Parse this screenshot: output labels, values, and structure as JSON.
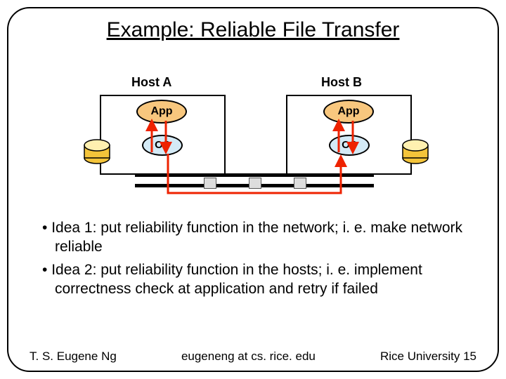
{
  "title": "Example: Reliable File Transfer",
  "hostA": {
    "label": "Host A",
    "app": "App",
    "os": "OS"
  },
  "hostB": {
    "label": "Host B",
    "app": "App",
    "os": "OS"
  },
  "bullets": {
    "idea1": "Idea 1: put reliability function in the network; i. e. make network reliable",
    "idea2": "Idea 2: put reliability function in the hosts; i. e. implement correctness check at application and retry if failed"
  },
  "footer": {
    "author": "T. S. Eugene Ng",
    "email": "eugeneng at cs. rice. edu",
    "org": "Rice University",
    "page": "15"
  }
}
